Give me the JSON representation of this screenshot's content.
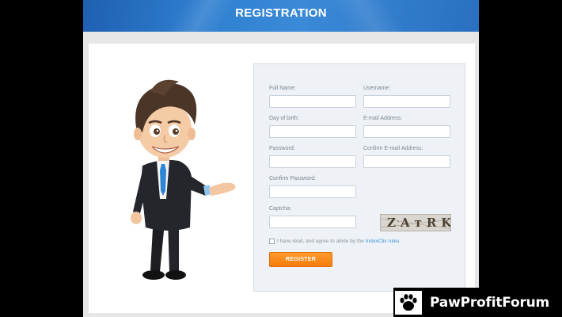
{
  "header": {
    "title": "REGISTRATION"
  },
  "form": {
    "fields": [
      {
        "label": "Full Name:",
        "value": ""
      },
      {
        "label": "Username:",
        "value": ""
      },
      {
        "label": "Day of birth:",
        "value": ""
      },
      {
        "label": "E-mail Address:",
        "value": ""
      },
      {
        "label": "Password:",
        "value": ""
      },
      {
        "label": "Confirm E-mail Address:",
        "value": ""
      },
      {
        "label": "Confirm Password:",
        "value": ""
      },
      {
        "label": "Captcha:",
        "value": ""
      }
    ],
    "captcha_text": "ZAтRK",
    "agree_text": "I have read, and agree to abide by the",
    "agree_link": "IndexClix rules",
    "agree_checked": false,
    "register_label": "REGISTER"
  },
  "watermark": {
    "text": "PawProfitForum"
  },
  "colors": {
    "header": "#2f7fd0",
    "button": "#f47c0a",
    "link": "#3a9ad8",
    "panel": "#eef1f5"
  }
}
